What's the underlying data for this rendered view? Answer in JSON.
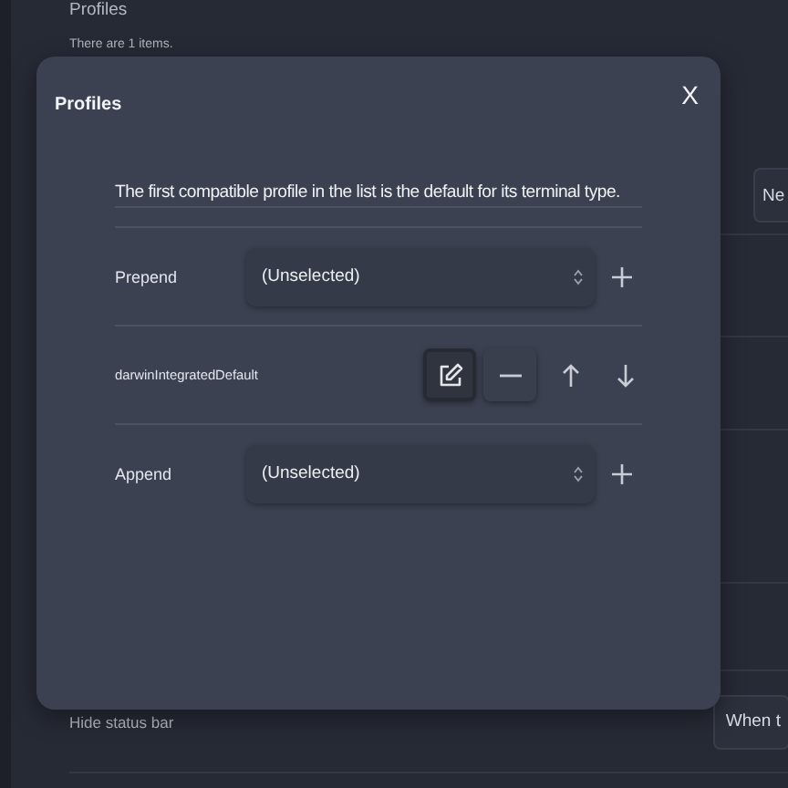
{
  "page": {
    "title": "Profiles",
    "subtitle": "There are 1 items.",
    "side_button": "Ne",
    "setting_label": "Hide status bar",
    "setting_value": "When t"
  },
  "dialog": {
    "title": "Profiles",
    "close": "X",
    "description": "The first compatible profile in the list is the default for its terminal type.",
    "rows": [
      {
        "kind": "select",
        "label": "Prepend",
        "value": "(Unselected)"
      },
      {
        "kind": "profile",
        "label": "darwinIntegratedDefault",
        "buttons": [
          {
            "kind": "edit",
            "focused": true
          },
          {
            "kind": "remove",
            "focused": false
          },
          {
            "kind": "up",
            "focused": false
          },
          {
            "kind": "down",
            "focused": false
          }
        ]
      },
      {
        "kind": "select",
        "label": "Append",
        "value": "(Unselected)"
      }
    ]
  }
}
